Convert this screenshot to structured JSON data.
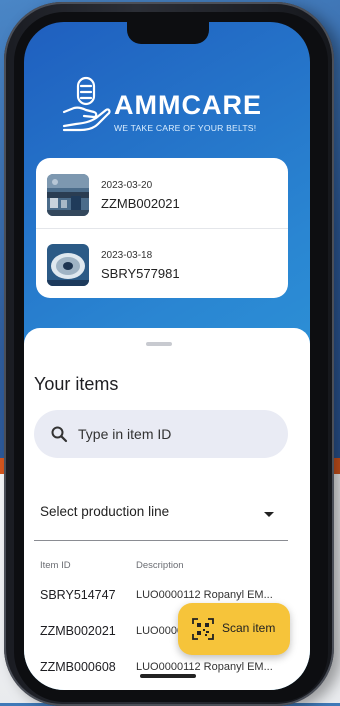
{
  "brand": {
    "name": "AMMCARE",
    "tagline": "WE TAKE CARE OF YOUR BELTS!"
  },
  "recent": [
    {
      "date": "2023-03-20",
      "id": "ZZMB002021",
      "thumb_icon": "conveyor-line-thumbnail"
    },
    {
      "date": "2023-03-18",
      "id": "SBRY577981",
      "thumb_icon": "belt-roll-thumbnail"
    }
  ],
  "items_panel": {
    "title": "Your items",
    "search_placeholder": "Type in item ID",
    "select_value": "Select production line",
    "columns": [
      "Item ID",
      "Description"
    ],
    "rows": [
      {
        "id": "SBRY514747",
        "description": "LUO0000112 Ropanyl EM..."
      },
      {
        "id": "ZZMB002021",
        "description": "LUO0000112 Ropanyl EM..."
      },
      {
        "id": "ZZMB000608",
        "description": "LUO0000112 Ropanyl EM..."
      }
    ]
  },
  "fab": {
    "label": "Scan item",
    "icon": "qr-scan-icon"
  },
  "colors": {
    "screen_gradient_start": "#1f5fbf",
    "screen_gradient_end": "#32a8e0",
    "fab": "#f6c43a",
    "backdrop_orange": "#d4561e"
  }
}
